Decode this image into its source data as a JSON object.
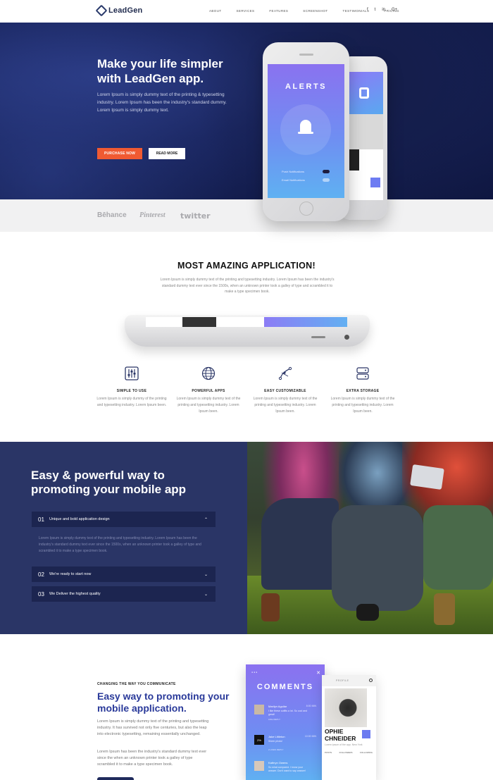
{
  "brand": {
    "name": "LeadGen"
  },
  "nav": {
    "items": [
      "ABOUT",
      "SERVICES",
      "FEATURES",
      "SCREENSHOT",
      "TESTIMONIALS",
      "PRICING"
    ],
    "social": [
      "f",
      "t",
      "in",
      "G+"
    ]
  },
  "hero": {
    "title": "Make your life simpler with LeadGen app.",
    "text": "Lorem Ipsum is simply dummy text of the printing & typesetting industry. Lorem Ipsum has been the industry's standard dummy. Lorem Ipsum is simply dummy text.",
    "purchase_label": "PURCHASE NOW",
    "read_label": "READ MORE",
    "phone": {
      "screen_title": "ALERTS",
      "toggle1_label": "Push Notifications",
      "toggle2_label": "Email Notifications",
      "toggle1_on": true,
      "toggle2_on": false
    }
  },
  "brands": [
    "Bēhance",
    "Pinterest",
    "twitter"
  ],
  "amazing": {
    "title": "MOST AMAZING APPLICATION!",
    "subtitle": "Lorem Ipsum is simply dummy text of the printing and typesetting industry. Lorem Ipsum has been the industry's standard dummy text ever since the 1500s, when an unknown printer took a galley of type and scrambled it to make a type specimen book."
  },
  "features": [
    {
      "icon": "sliders-icon",
      "title": "SIMPLE TO USE",
      "text": "Lorem Ipsum is simply dummy of the printing and typesetting industry. Lorem Ipsum been."
    },
    {
      "icon": "globe-icon",
      "title": "POWERFUL APPS",
      "text": "Lorem Ipsum is simply dummy text of the printing and typesetting industry. Lorem Ipsum been."
    },
    {
      "icon": "vector-icon",
      "title": "EASY CUSTOMIZABLE",
      "text": "Lorem Ipsum is simply dummy text of the printing and typesetting industry. Lorem Ipsum been."
    },
    {
      "icon": "storage-icon",
      "title": "EXTRA STORAGE",
      "text": "Lorem Ipsum is simply dummy text of the printing and typesetting industry. Lorem Ipsum been."
    }
  ],
  "easy": {
    "title": "Easy & powerful way to promoting your mobile app",
    "items": [
      {
        "num": "01",
        "label": "Unique and bold application design",
        "open": true
      },
      {
        "num": "02",
        "label": "We're ready to start now",
        "open": false
      },
      {
        "num": "03",
        "label": "We Deliver the highest quality",
        "open": false
      }
    ],
    "body": "Lorem Ipsum is simply dummy text of the printing and typesetting industry. Lorem Ipsum has been the industry's standard dummy text ever since the 1500s, when an unknown printer took a galley of type and scrambled it to make a type specimen book."
  },
  "communicate": {
    "eyebrow": "CHANGING THE WAY YOU COMMUNICATE",
    "title": "Easy way to promoting your mobile application.",
    "para1": "Lorem Ipsum is simply dummy text of the printing and typesetting industry. It has survived not only five centuries, but also the leap into electronic typesetting, remaining essentially unchanged.",
    "para2": "Lorem Ipsum has been the industry's standard dummy text ever since the when an unknown printer took a galley of type scrambled it to make a type specimen book."
  },
  "comments_phone": {
    "header": "COMMENTS",
    "comments": [
      {
        "name": "Marilyn Aguilar",
        "time": "8:00 MIN",
        "msg": "I like these outfits a lot. So cool and great!",
        "actions": "LIKE   REPLY",
        "avatar_color": "#c9b8a5"
      },
      {
        "name": "Jake Littleton",
        "time": "10:00 MIN",
        "msg": "Sheer photo!",
        "actions": "2 LIKES   REPLY",
        "avatar_color": "#111111",
        "avatar_text": "2%"
      },
      {
        "name": "Kathryn Owens",
        "time": "",
        "msg": "So what compared. I know your answer. Don't want to say answer!",
        "actions": "",
        "avatar_color": "#d7c8ba"
      }
    ]
  },
  "profile_card": {
    "header": "PROFILE",
    "name": "OPHIE CHNEIDER",
    "desc": "Lorem ipsum of the app. New York",
    "stats": [
      "POSTS",
      "FOLLOWERS",
      "FOLLOWING"
    ]
  }
}
